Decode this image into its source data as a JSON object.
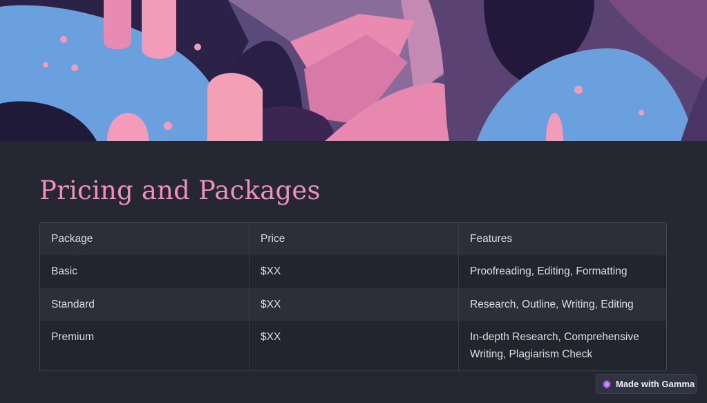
{
  "slide": {
    "title": "Pricing and Packages"
  },
  "table": {
    "headers": [
      "Package",
      "Price",
      "Features"
    ],
    "rows": [
      [
        "Basic",
        "$XX",
        "Proofreading, Editing, Formatting"
      ],
      [
        "Standard",
        "$XX",
        "Research, Outline, Writing, Editing"
      ],
      [
        "Premium",
        "$XX",
        "In-depth Research, Comprehensive Writing, Plagiarism Check"
      ]
    ]
  },
  "badge": {
    "label": "Made with Gamma",
    "icon": "gamma-logo-icon"
  },
  "colors": {
    "background": "#252832",
    "title": "#f08fc0",
    "table_text": "#dcdde2"
  }
}
